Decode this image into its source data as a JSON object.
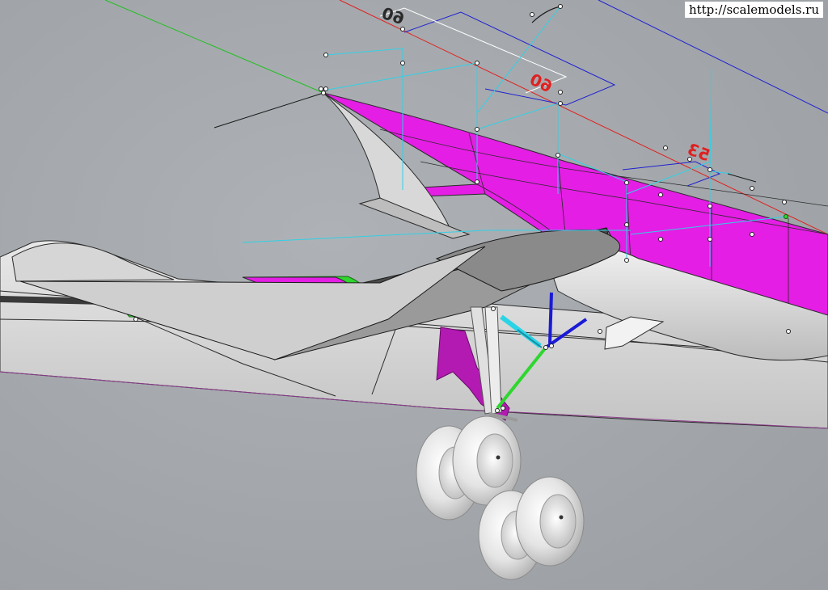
{
  "watermark": {
    "text": "http://scalemodels.ru"
  },
  "viewport": {
    "view_type": "perspective",
    "background": "#a3a7ab",
    "subject": "wing-with-main-landing-gear"
  },
  "dimension_labels": [
    {
      "id": "dim-1",
      "text": "60",
      "color": "#2a2a2a",
      "mirrored": true
    },
    {
      "id": "dim-2",
      "text": "60",
      "color": "#e02020",
      "mirrored": true
    },
    {
      "id": "dim-3",
      "text": "53",
      "color": "#e02020",
      "mirrored": true
    }
  ],
  "colors": {
    "surface_magenta": "#e41ee4",
    "surface_grey": "#c9c9c9",
    "surface_light": "#e6e6e6",
    "surface_dark": "#8f8f8f",
    "strut_green": "#2fd62f",
    "strut_blue": "#1a1ad6",
    "actuator_cyan": "#2ad4e6",
    "construction_cyan": "#31d0e6",
    "axis_red": "#e02020",
    "axis_green": "#20c020",
    "axis_blue": "#2020d0",
    "tyre": "#e2e2e2"
  }
}
